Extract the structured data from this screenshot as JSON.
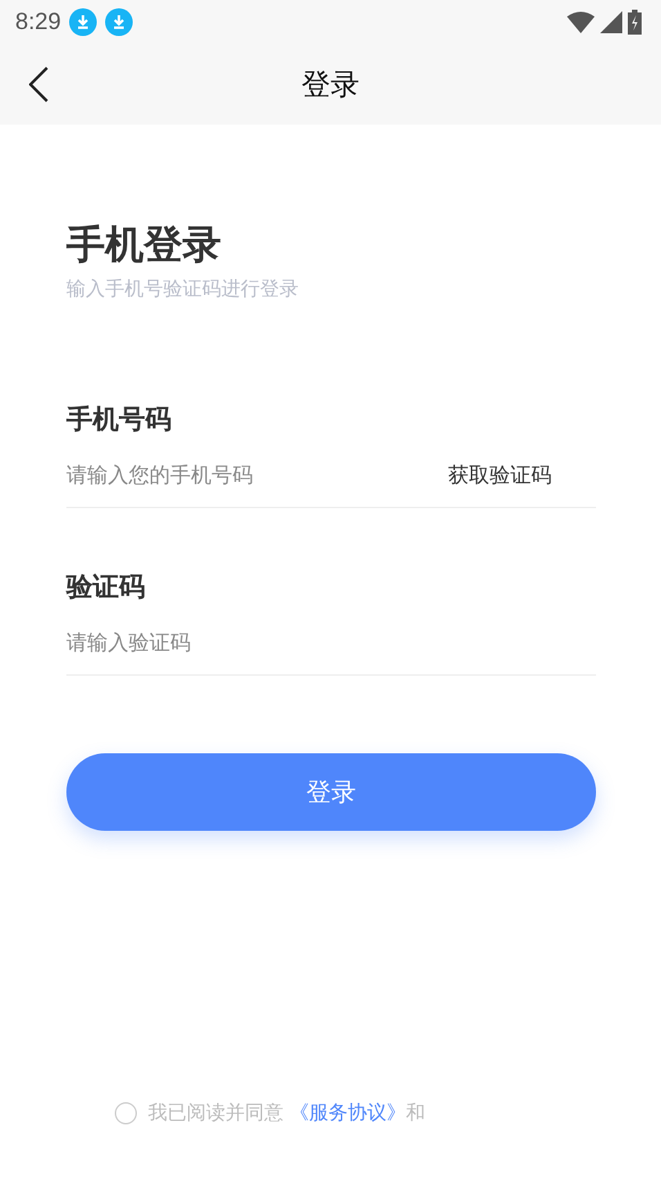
{
  "status_bar": {
    "time": "8:29",
    "notifications": [
      {
        "kind": "download"
      },
      {
        "kind": "download"
      }
    ]
  },
  "nav_bar": {
    "title": "登录"
  },
  "header": {
    "title": "手机登录",
    "subtitle": "输入手机号验证码进行登录"
  },
  "fields": [
    {
      "label": "手机号码",
      "placeholder": "请输入您的手机号码",
      "action": "获取验证码"
    },
    {
      "label": "验证码",
      "placeholder": "请输入验证码"
    }
  ],
  "login_button": "登录",
  "agreement": {
    "checked": false,
    "text": "我已阅读并同意",
    "link": "《服务协议》",
    "tail": "和"
  }
}
